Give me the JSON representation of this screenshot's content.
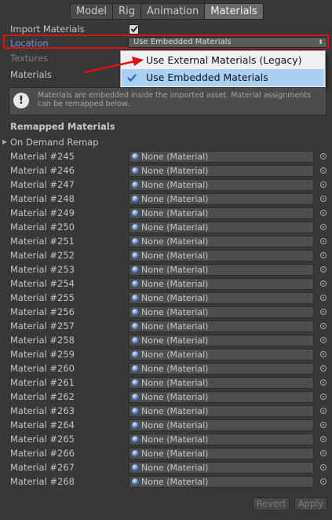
{
  "tabs": [
    "Model",
    "Rig",
    "Animation",
    "Materials"
  ],
  "active_tab": "Materials",
  "import_materials": {
    "label": "Import Materials",
    "checked": true
  },
  "location": {
    "label": "Location",
    "value": "Use Embedded Materials",
    "arrows": "⬍"
  },
  "textures": {
    "label": "Textures"
  },
  "materials": {
    "label": "Materials"
  },
  "popup": {
    "options": [
      {
        "label": "Use External Materials (Legacy)",
        "selected": false
      },
      {
        "label": "Use Embedded Materials",
        "selected": true
      }
    ]
  },
  "help": {
    "text": "Materials are embedded inside the imported asset. Material assignments can be remapped below."
  },
  "remapped_header": "Remapped Materials",
  "on_demand_remap": "On Demand Remap",
  "rows": [
    {
      "name": "Material #245",
      "value": "None (Material)"
    },
    {
      "name": "Material #246",
      "value": "None (Material)"
    },
    {
      "name": "Material #247",
      "value": "None (Material)"
    },
    {
      "name": "Material #248",
      "value": "None (Material)"
    },
    {
      "name": "Material #249",
      "value": "None (Material)"
    },
    {
      "name": "Material #250",
      "value": "None (Material)"
    },
    {
      "name": "Material #251",
      "value": "None (Material)"
    },
    {
      "name": "Material #252",
      "value": "None (Material)"
    },
    {
      "name": "Material #253",
      "value": "None (Material)"
    },
    {
      "name": "Material #254",
      "value": "None (Material)"
    },
    {
      "name": "Material #255",
      "value": "None (Material)"
    },
    {
      "name": "Material #256",
      "value": "None (Material)"
    },
    {
      "name": "Material #257",
      "value": "None (Material)"
    },
    {
      "name": "Material #258",
      "value": "None (Material)"
    },
    {
      "name": "Material #259",
      "value": "None (Material)"
    },
    {
      "name": "Material #260",
      "value": "None (Material)"
    },
    {
      "name": "Material #261",
      "value": "None (Material)"
    },
    {
      "name": "Material #262",
      "value": "None (Material)"
    },
    {
      "name": "Material #263",
      "value": "None (Material)"
    },
    {
      "name": "Material #264",
      "value": "None (Material)"
    },
    {
      "name": "Material #265",
      "value": "None (Material)"
    },
    {
      "name": "Material #266",
      "value": "None (Material)"
    },
    {
      "name": "Material #267",
      "value": "None (Material)"
    },
    {
      "name": "Material #268",
      "value": "None (Material)"
    }
  ],
  "buttons": {
    "revert": "Revert",
    "apply": "Apply"
  },
  "colors": {
    "background": "#383838",
    "highlight": "#e01010",
    "location_label": "#6d95e6",
    "selected_option": "#a9d0f3"
  }
}
